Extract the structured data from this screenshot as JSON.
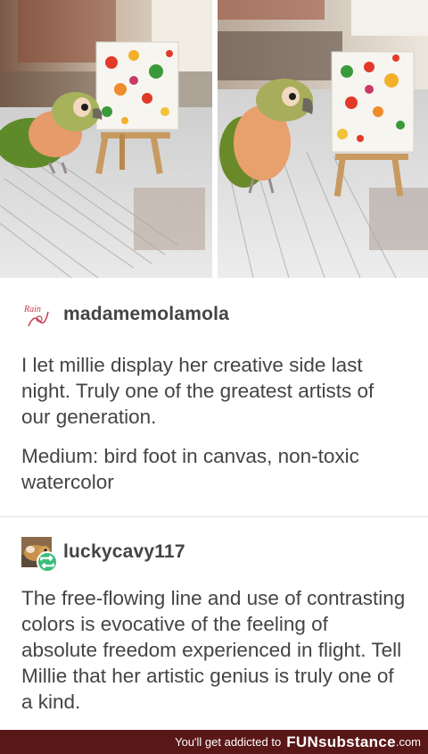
{
  "post1": {
    "username": "madamemolamola",
    "paragraph1": "I let millie display her creative side last night. Truly one of the greatest artists of our generation.",
    "paragraph2": "Medium: bird foot in canvas, non-toxic watercolor"
  },
  "post2": {
    "username": "luckycavy117",
    "paragraph1": "The free-flowing line and use of contrasting colors is evocative of the feeling of absolute freedom experienced in flight. Tell Millie that her artistic genius is truly one of a kind."
  },
  "footer": {
    "tagline": "You'll get addicted to",
    "brand": "FUNsubstance",
    "domain": ".com"
  },
  "colors": {
    "footer_bg": "#5a1717",
    "reblog_green": "#3dbd7b"
  }
}
